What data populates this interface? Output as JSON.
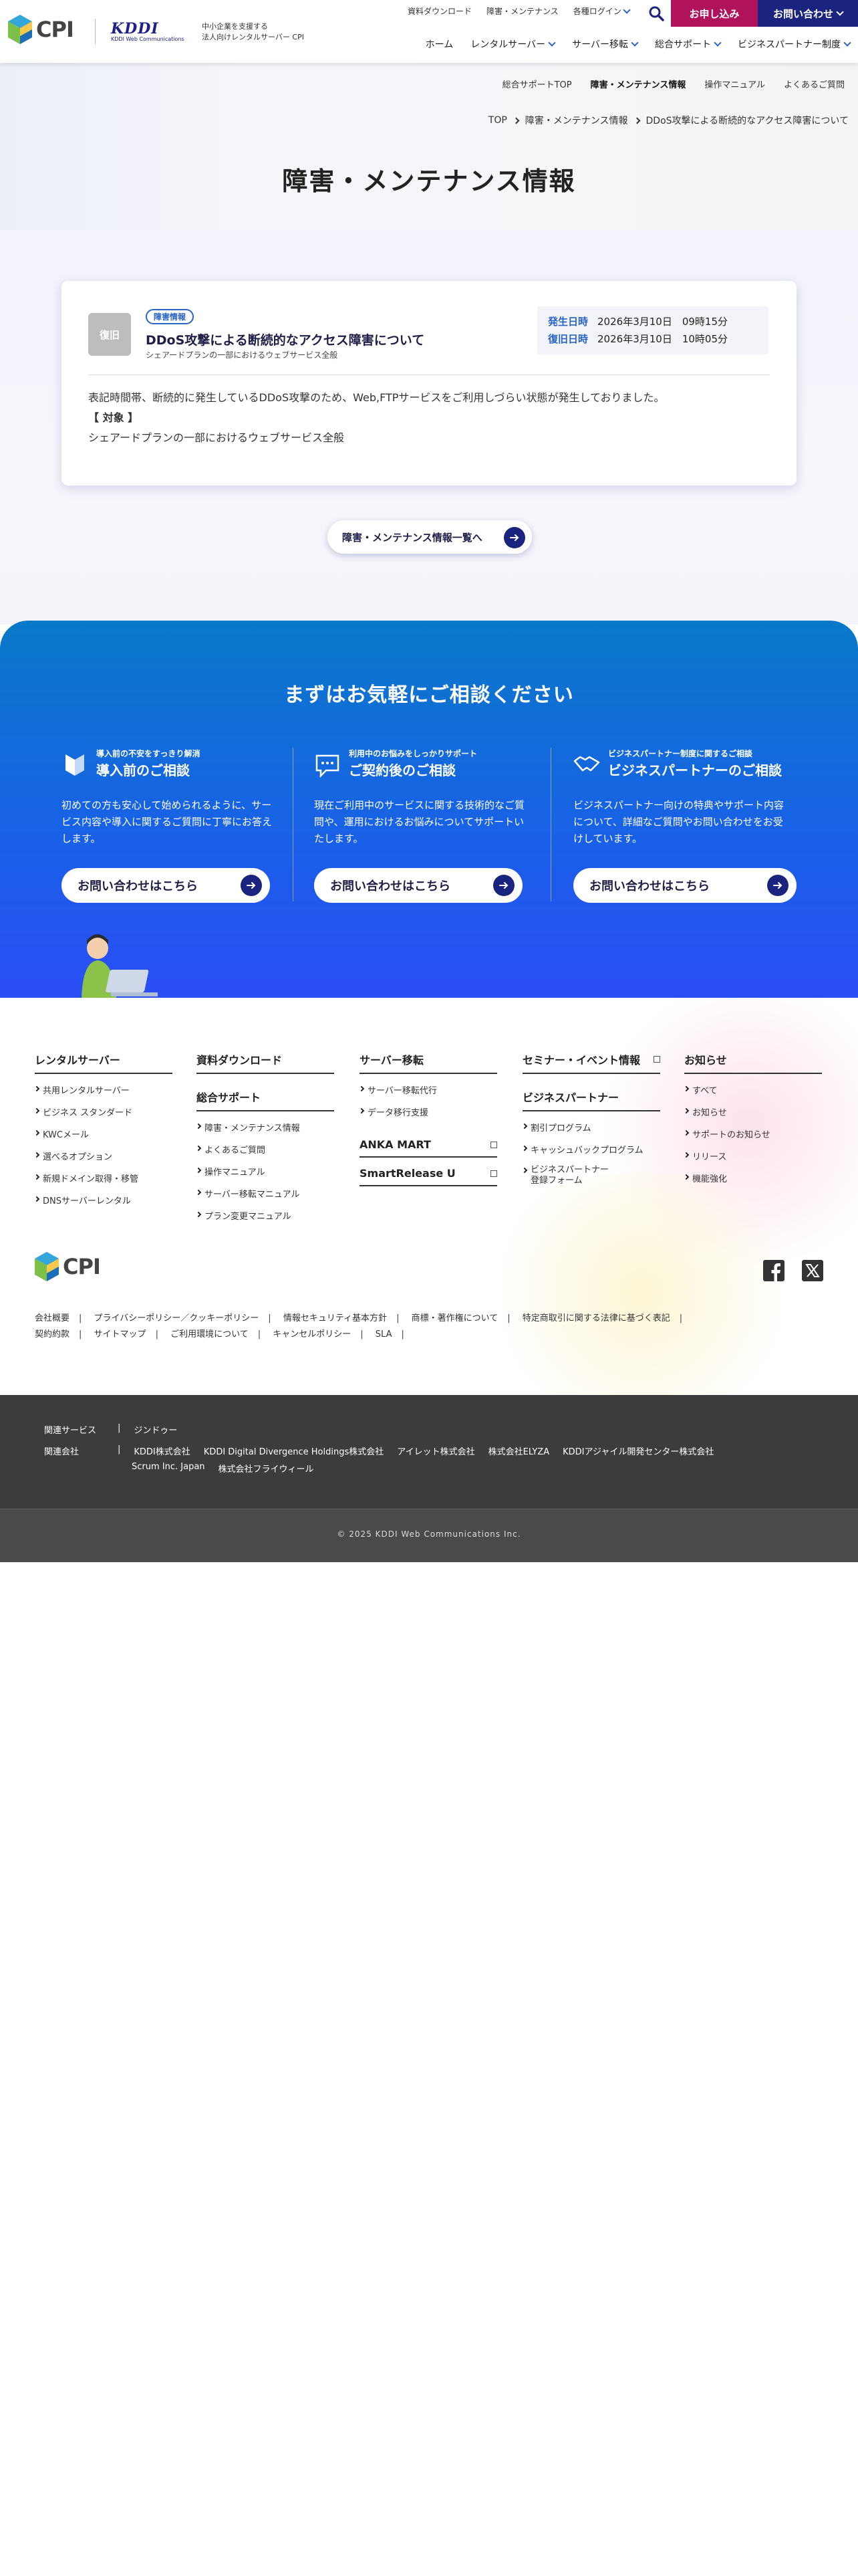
{
  "header": {
    "logo_text": "CPI",
    "kddi_logo": "KDDI",
    "kddi_sub": "KDDI Web Communications",
    "tagline_1": "中小企業を支援する",
    "tagline_2": "法人向けレンタルサーバー CPI",
    "util": [
      "資料ダウンロード",
      "障害・メンテナンス",
      "各種ログイン"
    ],
    "apply_label": "お申し込み",
    "contact_label": "お問い合わせ",
    "gnav": [
      "ホーム",
      "レンタルサーバー",
      "サーバー移転",
      "総合サポート",
      "ビジネスパートナー制度"
    ]
  },
  "hero": {
    "subnav": [
      "総合サポートTOP",
      "障害・メンテナンス情報",
      "操作マニュアル",
      "よくあるご質問"
    ],
    "breadcrumb": [
      "TOP",
      "障害・メンテナンス情報",
      "DDoS攻撃による断続的なアクセス障害について"
    ],
    "title": "障害・メンテナンス情報"
  },
  "notice": {
    "status": "復旧",
    "category": "障害情報",
    "title": "DDoS攻撃による断続的なアクセス障害について",
    "subtitle": "シェアードプランの一部におけるウェブサービス全般",
    "occur_label": "発生日時",
    "occur_value": "2026年3月10日　09時15分",
    "recover_label": "復旧日時",
    "recover_value": "2026年3月10日　10時05分",
    "body_1": "表記時間帯、断続的に発生しているDDoS攻撃のため、Web,FTPサービスをご利用しづらい状態が発生しておりました。",
    "body_2": "【 対象 】",
    "body_3": "シェアードプランの一部におけるウェブサービス全般"
  },
  "list_button": "障害・メンテナンス情報一覧へ",
  "consult": {
    "title": "まずはお気軽にご相談ください",
    "cols": [
      {
        "small": "導入前の不安をすっきり解消",
        "big": "導入前のご相談",
        "text": "初めての方も安心して始められるように、サービス内容や導入に関するご質問に丁寧にお答えします。",
        "button": "お問い合わせはこちら"
      },
      {
        "small": "利用中のお悩みをしっかりサポート",
        "big": "ご契約後のご相談",
        "text": "現在ご利用中のサービスに関する技術的なご質問や、運用におけるお悩みについてサポートいたします。",
        "button": "お問い合わせはこちら"
      },
      {
        "small": "ビジネスパートナー制度に関するご相談",
        "big": "ビジネスパートナーのご相談",
        "text": "ビジネスパートナー向けの特典やサポート内容について、詳細なご質問やお問い合わせをお受けしています。",
        "button": "お問い合わせはこちら"
      }
    ]
  },
  "footer": {
    "col1": {
      "head": "レンタルサーバー",
      "items": [
        "共用レンタルサーバー",
        "ビジネス スタンダード",
        "KWCメール",
        "選べるオプション",
        "新規ドメイン取得・移管",
        "DNSサーバーレンタル"
      ]
    },
    "col2": {
      "head": "資料ダウンロード",
      "head2": "総合サポート",
      "items": [
        "障害・メンテナンス情報",
        "よくあるご質問",
        "操作マニュアル",
        "サーバー移転マニュアル",
        "プラン変更マニュアル"
      ]
    },
    "col3": {
      "head": "サーバー移転",
      "items": [
        "サーバー移転代行",
        "データ移行支援"
      ],
      "head2": "ANKA MART",
      "head3": "SmartRelease U"
    },
    "col4": {
      "head": "セミナー・イベント情報",
      "head2": "ビジネスパートナー",
      "items": [
        "割引プログラム",
        "キャッシュバックプログラム",
        "ビジネスパートナー\n登録フォーム"
      ]
    },
    "col5": {
      "head": "お知らせ",
      "items": [
        "すべて",
        "お知らせ",
        "サポートのお知らせ",
        "リリース",
        "機能強化"
      ]
    },
    "logo_text": "CPI",
    "legal_1": [
      "会社概要",
      "プライバシーポリシー／クッキーポリシー",
      "情報セキュリティ基本方針",
      "商標・著作権について",
      "特定商取引に関する法律に基づく表記"
    ],
    "legal_2": [
      "契約約款",
      "サイトマップ",
      "ご利用環境について",
      "キャンセルポリシー",
      "SLA"
    ]
  },
  "dark": {
    "related_label": "関連サービス",
    "related": [
      "ジンドゥー"
    ],
    "company_label": "関連会社",
    "companies_1": [
      "KDDI株式会社",
      "KDDI Digital Divergence Holdings株式会社",
      "アイレット株式会社",
      "株式会社ELYZA",
      "KDDIアジャイル開発センター株式会社"
    ],
    "companies_2": [
      "Scrum Inc. Japan",
      "株式会社フライウィール"
    ],
    "copyright": "© 2025 KDDI Web Communications Inc."
  },
  "colors": {
    "navy": "#1a237e",
    "accent": "#b0125b",
    "blue": "#2a64c5"
  }
}
